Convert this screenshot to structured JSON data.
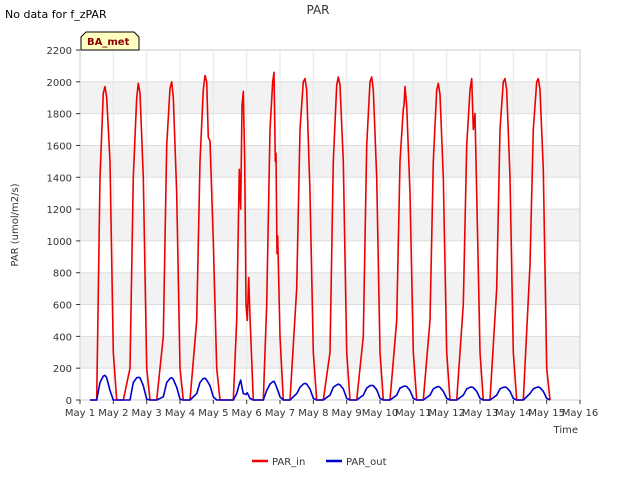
{
  "header": {
    "no_data_note": "No data for f_zPAR"
  },
  "chart_data": {
    "type": "line",
    "title": "PAR",
    "xlabel": "Time",
    "ylabel": "PAR (umol/m2/s)",
    "badge": "BA_met",
    "ylim": [
      0,
      2200
    ],
    "xlim": [
      1,
      16
    ],
    "yticks": [
      0,
      200,
      400,
      600,
      800,
      1000,
      1200,
      1400,
      1600,
      1800,
      2000,
      2200
    ],
    "xticks": [
      {
        "value": 1,
        "label": "May 1"
      },
      {
        "value": 2,
        "label": "May 2"
      },
      {
        "value": 3,
        "label": "May 3"
      },
      {
        "value": 4,
        "label": "May 4"
      },
      {
        "value": 5,
        "label": "May 5"
      },
      {
        "value": 6,
        "label": "May 6"
      },
      {
        "value": 7,
        "label": "May 7"
      },
      {
        "value": 8,
        "label": "May 8"
      },
      {
        "value": 9,
        "label": "May 9"
      },
      {
        "value": 10,
        "label": "May 10"
      },
      {
        "value": 11,
        "label": "May 11"
      },
      {
        "value": 12,
        "label": "May 12"
      },
      {
        "value": 13,
        "label": "May 13"
      },
      {
        "value": 14,
        "label": "May 14"
      },
      {
        "value": 15,
        "label": "May 15"
      },
      {
        "value": 16,
        "label": "May 16"
      }
    ],
    "grid": true,
    "legend_position": "bottom-center",
    "series": [
      {
        "name": "PAR_in",
        "color": "#ee0000",
        "values": [
          [
            1.3,
            0
          ],
          [
            1.5,
            0
          ],
          [
            1.6,
            1400
          ],
          [
            1.7,
            1930
          ],
          [
            1.75,
            1970
          ],
          [
            1.8,
            1900
          ],
          [
            1.9,
            1500
          ],
          [
            2.0,
            300
          ],
          [
            2.1,
            0
          ],
          [
            2.3,
            0
          ],
          [
            2.5,
            200
          ],
          [
            2.6,
            1400
          ],
          [
            2.7,
            1900
          ],
          [
            2.75,
            1990
          ],
          [
            2.8,
            1930
          ],
          [
            2.9,
            1400
          ],
          [
            3.0,
            200
          ],
          [
            3.1,
            0
          ],
          [
            3.3,
            0
          ],
          [
            3.5,
            400
          ],
          [
            3.6,
            1600
          ],
          [
            3.7,
            1960
          ],
          [
            3.75,
            2000
          ],
          [
            3.8,
            1900
          ],
          [
            3.9,
            1300
          ],
          [
            4.0,
            200
          ],
          [
            4.1,
            0
          ],
          [
            4.3,
            0
          ],
          [
            4.5,
            500
          ],
          [
            4.6,
            1500
          ],
          [
            4.7,
            1950
          ],
          [
            4.75,
            2040
          ],
          [
            4.8,
            2000
          ],
          [
            4.85,
            1650
          ],
          [
            4.9,
            1630
          ],
          [
            5.0,
            1000
          ],
          [
            5.1,
            200
          ],
          [
            5.2,
            0
          ],
          [
            5.6,
            0
          ],
          [
            5.7,
            500
          ],
          [
            5.78,
            1450
          ],
          [
            5.82,
            1200
          ],
          [
            5.86,
            1850
          ],
          [
            5.9,
            1940
          ],
          [
            5.94,
            1500
          ],
          [
            5.98,
            600
          ],
          [
            6.02,
            500
          ],
          [
            6.06,
            770
          ],
          [
            6.1,
            520
          ],
          [
            6.2,
            0
          ],
          [
            6.5,
            0
          ],
          [
            6.6,
            600
          ],
          [
            6.7,
            1700
          ],
          [
            6.78,
            2000
          ],
          [
            6.82,
            2060
          ],
          [
            6.86,
            1500
          ],
          [
            6.88,
            1550
          ],
          [
            6.91,
            920
          ],
          [
            6.93,
            1030
          ],
          [
            7.0,
            400
          ],
          [
            7.1,
            0
          ],
          [
            7.3,
            0
          ],
          [
            7.5,
            700
          ],
          [
            7.6,
            1700
          ],
          [
            7.7,
            2000
          ],
          [
            7.75,
            2020
          ],
          [
            7.8,
            1950
          ],
          [
            7.9,
            1300
          ],
          [
            8.0,
            300
          ],
          [
            8.1,
            0
          ],
          [
            8.3,
            0
          ],
          [
            8.5,
            300
          ],
          [
            8.6,
            1500
          ],
          [
            8.7,
            1980
          ],
          [
            8.75,
            2030
          ],
          [
            8.8,
            1980
          ],
          [
            8.9,
            1500
          ],
          [
            9.0,
            300
          ],
          [
            9.1,
            0
          ],
          [
            9.3,
            0
          ],
          [
            9.5,
            400
          ],
          [
            9.6,
            1600
          ],
          [
            9.7,
            2000
          ],
          [
            9.75,
            2030
          ],
          [
            9.8,
            1950
          ],
          [
            9.9,
            1400
          ],
          [
            10.0,
            300
          ],
          [
            10.1,
            0
          ],
          [
            10.3,
            0
          ],
          [
            10.5,
            500
          ],
          [
            10.6,
            1500
          ],
          [
            10.7,
            1830
          ],
          [
            10.72,
            1850
          ],
          [
            10.75,
            1970
          ],
          [
            10.8,
            1850
          ],
          [
            10.9,
            1300
          ],
          [
            11.0,
            300
          ],
          [
            11.1,
            0
          ],
          [
            11.3,
            0
          ],
          [
            11.5,
            500
          ],
          [
            11.6,
            1500
          ],
          [
            11.7,
            1950
          ],
          [
            11.75,
            1990
          ],
          [
            11.8,
            1920
          ],
          [
            11.9,
            1400
          ],
          [
            12.0,
            300
          ],
          [
            12.1,
            0
          ],
          [
            12.3,
            0
          ],
          [
            12.5,
            600
          ],
          [
            12.6,
            1600
          ],
          [
            12.7,
            1950
          ],
          [
            12.75,
            2020
          ],
          [
            12.8,
            1700
          ],
          [
            12.85,
            1800
          ],
          [
            12.9,
            1300
          ],
          [
            13.0,
            300
          ],
          [
            13.1,
            0
          ],
          [
            13.3,
            0
          ],
          [
            13.5,
            700
          ],
          [
            13.6,
            1700
          ],
          [
            13.7,
            2000
          ],
          [
            13.75,
            2020
          ],
          [
            13.8,
            1950
          ],
          [
            13.9,
            1400
          ],
          [
            14.0,
            300
          ],
          [
            14.1,
            0
          ],
          [
            14.3,
            0
          ],
          [
            14.5,
            850
          ],
          [
            14.6,
            1700
          ],
          [
            14.7,
            2000
          ],
          [
            14.75,
            2020
          ],
          [
            14.8,
            1950
          ],
          [
            14.9,
            1450
          ],
          [
            15.0,
            200
          ],
          [
            15.1,
            0
          ]
        ]
      },
      {
        "name": "PAR_out",
        "color": "#0000cc",
        "values": [
          [
            1.3,
            0
          ],
          [
            1.5,
            0
          ],
          [
            1.6,
            110
          ],
          [
            1.7,
            150
          ],
          [
            1.75,
            155
          ],
          [
            1.8,
            140
          ],
          [
            1.9,
            60
          ],
          [
            2.0,
            0
          ],
          [
            2.1,
            0
          ],
          [
            2.3,
            0
          ],
          [
            2.5,
            0
          ],
          [
            2.6,
            110
          ],
          [
            2.7,
            140
          ],
          [
            2.75,
            142
          ],
          [
            2.8,
            140
          ],
          [
            2.9,
            90
          ],
          [
            3.0,
            5
          ],
          [
            3.1,
            0
          ],
          [
            3.3,
            0
          ],
          [
            3.5,
            20
          ],
          [
            3.6,
            110
          ],
          [
            3.7,
            135
          ],
          [
            3.75,
            140
          ],
          [
            3.8,
            130
          ],
          [
            3.9,
            80
          ],
          [
            4.0,
            5
          ],
          [
            4.1,
            0
          ],
          [
            4.3,
            0
          ],
          [
            4.5,
            40
          ],
          [
            4.6,
            110
          ],
          [
            4.7,
            135
          ],
          [
            4.75,
            137
          ],
          [
            4.8,
            125
          ],
          [
            4.9,
            90
          ],
          [
            5.0,
            20
          ],
          [
            5.1,
            0
          ],
          [
            5.6,
            0
          ],
          [
            5.7,
            40
          ],
          [
            5.78,
            100
          ],
          [
            5.82,
            125
          ],
          [
            5.86,
            80
          ],
          [
            5.9,
            40
          ],
          [
            5.98,
            35
          ],
          [
            6.02,
            45
          ],
          [
            6.1,
            10
          ],
          [
            6.2,
            0
          ],
          [
            6.5,
            0
          ],
          [
            6.6,
            60
          ],
          [
            6.7,
            100
          ],
          [
            6.78,
            115
          ],
          [
            6.82,
            118
          ],
          [
            6.86,
            100
          ],
          [
            6.9,
            80
          ],
          [
            7.0,
            20
          ],
          [
            7.1,
            0
          ],
          [
            7.3,
            0
          ],
          [
            7.5,
            40
          ],
          [
            7.6,
            80
          ],
          [
            7.7,
            100
          ],
          [
            7.75,
            105
          ],
          [
            7.8,
            100
          ],
          [
            7.9,
            70
          ],
          [
            8.0,
            10
          ],
          [
            8.1,
            0
          ],
          [
            8.3,
            0
          ],
          [
            8.5,
            30
          ],
          [
            8.6,
            80
          ],
          [
            8.7,
            95
          ],
          [
            8.75,
            100
          ],
          [
            8.8,
            95
          ],
          [
            8.9,
            70
          ],
          [
            9.0,
            10
          ],
          [
            9.1,
            0
          ],
          [
            9.3,
            0
          ],
          [
            9.5,
            30
          ],
          [
            9.6,
            75
          ],
          [
            9.7,
            90
          ],
          [
            9.75,
            92
          ],
          [
            9.8,
            90
          ],
          [
            9.9,
            65
          ],
          [
            10.0,
            10
          ],
          [
            10.1,
            0
          ],
          [
            10.3,
            0
          ],
          [
            10.5,
            30
          ],
          [
            10.6,
            75
          ],
          [
            10.7,
            85
          ],
          [
            10.75,
            88
          ],
          [
            10.8,
            85
          ],
          [
            10.9,
            60
          ],
          [
            11.0,
            10
          ],
          [
            11.1,
            0
          ],
          [
            11.3,
            0
          ],
          [
            11.5,
            30
          ],
          [
            11.6,
            70
          ],
          [
            11.7,
            82
          ],
          [
            11.75,
            85
          ],
          [
            11.8,
            80
          ],
          [
            11.9,
            55
          ],
          [
            12.0,
            10
          ],
          [
            12.1,
            0
          ],
          [
            12.3,
            0
          ],
          [
            12.5,
            30
          ],
          [
            12.6,
            70
          ],
          [
            12.7,
            80
          ],
          [
            12.75,
            82
          ],
          [
            12.8,
            78
          ],
          [
            12.9,
            55
          ],
          [
            13.0,
            10
          ],
          [
            13.1,
            0
          ],
          [
            13.3,
            0
          ],
          [
            13.5,
            30
          ],
          [
            13.6,
            70
          ],
          [
            13.7,
            80
          ],
          [
            13.75,
            82
          ],
          [
            13.8,
            78
          ],
          [
            13.9,
            55
          ],
          [
            14.0,
            10
          ],
          [
            14.1,
            0
          ],
          [
            14.3,
            0
          ],
          [
            14.5,
            40
          ],
          [
            14.6,
            70
          ],
          [
            14.7,
            80
          ],
          [
            14.75,
            82
          ],
          [
            14.8,
            78
          ],
          [
            14.9,
            55
          ],
          [
            15.0,
            10
          ],
          [
            15.1,
            0
          ]
        ]
      }
    ]
  }
}
